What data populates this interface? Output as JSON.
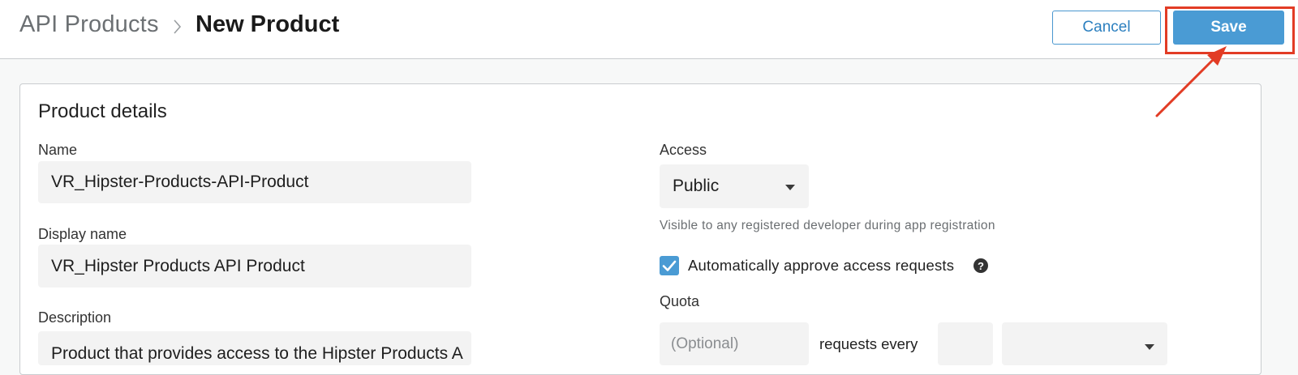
{
  "header": {
    "breadcrumb_root": "API Products",
    "breadcrumb_current": "New Product",
    "cancel_label": "Cancel",
    "save_label": "Save"
  },
  "product_details": {
    "section_title": "Product details",
    "name_label": "Name",
    "name_value": "VR_Hipster-Products-API-Product",
    "display_name_label": "Display name",
    "display_name_value": "VR_Hipster Products API Product",
    "description_label": "Description",
    "description_value": "Product that provides access to the Hipster Products A"
  },
  "access": {
    "label": "Access",
    "selected": "Public",
    "helper": "Visible to any registered developer during app registration",
    "auto_approve_label": "Automatically approve access requests",
    "auto_approve_checked": true,
    "help_icon": "question-circle-icon"
  },
  "quota": {
    "label": "Quota",
    "requests_placeholder": "(Optional)",
    "requests_every_label": "requests every",
    "interval_value": "",
    "unit_selected": ""
  },
  "colors": {
    "accent": "#4a9bd4",
    "annotation": "#e23c25"
  }
}
